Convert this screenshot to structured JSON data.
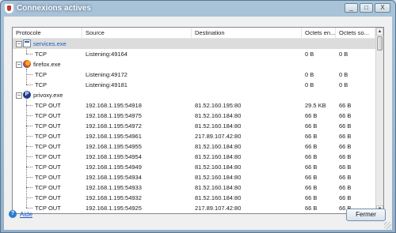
{
  "window": {
    "title": "Connexions actives"
  },
  "window_buttons": {
    "minimize": "_",
    "maximize": "□",
    "close": "X"
  },
  "columns": [
    "Protocole",
    "Source",
    "Destination",
    "Octets en...",
    "Octets so..."
  ],
  "processes": [
    {
      "name": "services.exe",
      "icon": "services-icon",
      "selected": true,
      "link": true,
      "connections": [
        {
          "protocol": "TCP",
          "source": "Listening:49164",
          "destination": "",
          "bytes_in": "0 B",
          "bytes_out": "0 B"
        }
      ]
    },
    {
      "name": "firefox.exe",
      "icon": "firefox-icon",
      "selected": false,
      "link": false,
      "connections": [
        {
          "protocol": "TCP",
          "source": "Listening:49172",
          "destination": "",
          "bytes_in": "0 B",
          "bytes_out": "0 B"
        },
        {
          "protocol": "TCP",
          "source": "Listening:49181",
          "destination": "",
          "bytes_in": "0 B",
          "bytes_out": "0 B"
        }
      ]
    },
    {
      "name": "privoxy.exe",
      "icon": "privoxy-icon",
      "selected": false,
      "link": false,
      "connections": [
        {
          "protocol": "TCP OUT",
          "source": "192.168.1.195:54918",
          "destination": "81.52.160.195:80",
          "bytes_in": "29.5 KB",
          "bytes_out": "66 B"
        },
        {
          "protocol": "TCP OUT",
          "source": "192.168.1.195:54975",
          "destination": "81.52.160.184:80",
          "bytes_in": "66 B",
          "bytes_out": "66 B"
        },
        {
          "protocol": "TCP OUT",
          "source": "192.168.1.195:54972",
          "destination": "81.52.160.184:80",
          "bytes_in": "66 B",
          "bytes_out": "66 B"
        },
        {
          "protocol": "TCP OUT",
          "source": "192.168.1.195:54961",
          "destination": "217.89.107.42:80",
          "bytes_in": "66 B",
          "bytes_out": "66 B"
        },
        {
          "protocol": "TCP OUT",
          "source": "192.168.1.195:54955",
          "destination": "81.52.160.184:80",
          "bytes_in": "66 B",
          "bytes_out": "66 B"
        },
        {
          "protocol": "TCP OUT",
          "source": "192.168.1.195:54954",
          "destination": "81.52.160.184:80",
          "bytes_in": "66 B",
          "bytes_out": "66 B"
        },
        {
          "protocol": "TCP OUT",
          "source": "192.168.1.195:54949",
          "destination": "81.52.160.184:80",
          "bytes_in": "66 B",
          "bytes_out": "66 B"
        },
        {
          "protocol": "TCP OUT",
          "source": "192.168.1.195:54934",
          "destination": "81.52.160.184:80",
          "bytes_in": "66 B",
          "bytes_out": "66 B"
        },
        {
          "protocol": "TCP OUT",
          "source": "192.168.1.195:54933",
          "destination": "81.52.160.184:80",
          "bytes_in": "66 B",
          "bytes_out": "66 B"
        },
        {
          "protocol": "TCP OUT",
          "source": "192.168.1.195:54932",
          "destination": "81.52.160.184:80",
          "bytes_in": "66 B",
          "bytes_out": "66 B"
        },
        {
          "protocol": "TCP OUT",
          "source": "192.168.1.195:54925",
          "destination": "217.89.107.42:80",
          "bytes_in": "66 B",
          "bytes_out": "66 B"
        }
      ]
    }
  ],
  "footer": {
    "help_label": "Aide",
    "close_label": "Fermer"
  },
  "colors": {
    "titlebar": "#93b0c8",
    "link": "#1e5bc6",
    "selection": "#dcdcdc"
  }
}
